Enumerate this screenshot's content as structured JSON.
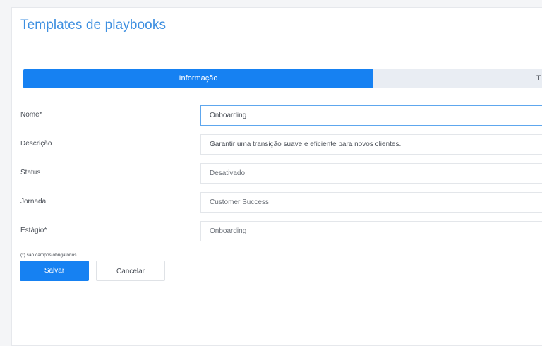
{
  "page": {
    "title": "Templates de playbooks"
  },
  "tabs": [
    {
      "label": "Informação",
      "active": true
    },
    {
      "label": "T",
      "active": false
    }
  ],
  "form": {
    "nome": {
      "label": "Nome*",
      "value": "Onboarding"
    },
    "descricao": {
      "label": "Descrição",
      "value": "Garantir uma transição suave e eficiente para novos clientes."
    },
    "status": {
      "label": "Status",
      "value": "Desativado"
    },
    "jornada": {
      "label": "Jornada",
      "value": "Customer Success"
    },
    "estagio": {
      "label": "Estágio*",
      "value": "Onboarding"
    }
  },
  "required_note": "(*) são campos obrigatórios",
  "actions": {
    "save_label": "Salvar",
    "cancel_label": "Cancelar"
  },
  "colors": {
    "accent": "#1681f2",
    "title": "#3d8fe0",
    "inactive_tab": "#e9edf3"
  }
}
